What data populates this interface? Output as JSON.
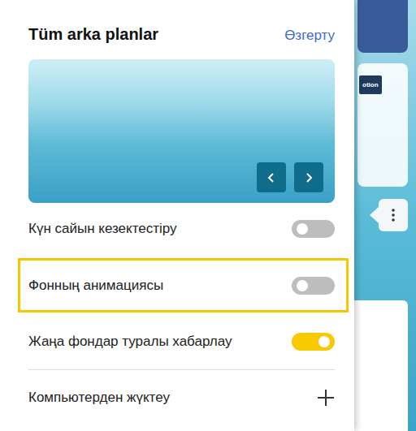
{
  "panel": {
    "title": "Tüm arka planlar",
    "change_link": "Өзгерту"
  },
  "settings": [
    {
      "label": "Күн сайын кезектестіру",
      "on": false,
      "highlighted": false
    },
    {
      "label": "Фонның анимациясы",
      "on": false,
      "highlighted": true
    },
    {
      "label": "Жаңа фондар туралы хабарлау",
      "on": true,
      "highlighted": false
    }
  ],
  "upload": {
    "label": "Компьютерден жүктеу"
  },
  "background": {
    "card_button": "otion"
  }
}
